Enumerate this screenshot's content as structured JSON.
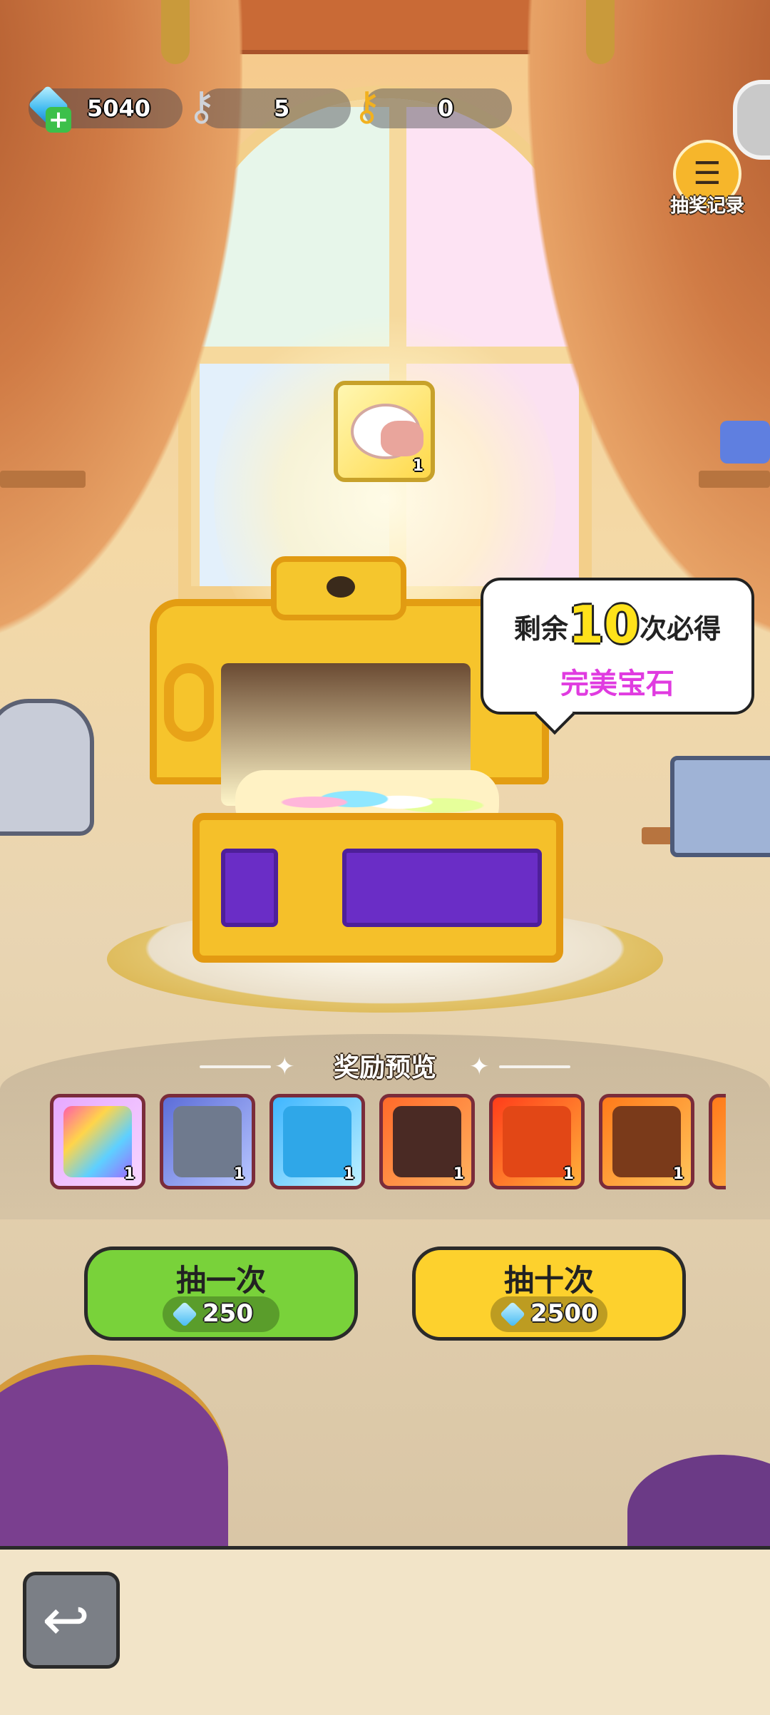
{
  "resources": {
    "gems": {
      "icon": "gem-icon",
      "value": "5040",
      "add_icon": "plus-icon"
    },
    "silver_keys": {
      "icon": "silver-key-icon",
      "value": "5"
    },
    "gold_keys": {
      "icon": "gold-key-icon",
      "value": "0"
    }
  },
  "record_button": {
    "icon": "record-icon",
    "label": "抽奖记录"
  },
  "featured_reward": {
    "icon": "pet-icon",
    "count": "1"
  },
  "bubble": {
    "prefix": "剩余",
    "number": "10",
    "suffix": "次必得",
    "reward": "完美宝石"
  },
  "preview": {
    "title": "奖励预览",
    "items": [
      {
        "icon": "mystery-gem-box-icon",
        "count": "1"
      },
      {
        "icon": "armored-knight-icon",
        "count": "1"
      },
      {
        "icon": "blue-beast-icon",
        "count": "1"
      },
      {
        "icon": "martial-hero-icon",
        "count": "1"
      },
      {
        "icon": "fire-dragon-icon",
        "count": "1"
      },
      {
        "icon": "lava-golem-icon",
        "count": "1"
      }
    ]
  },
  "draw_once": {
    "label": "抽一次",
    "price": "250"
  },
  "draw_ten": {
    "label": "抽十次",
    "price": "2500"
  },
  "back_button": {
    "icon": "back-arrow-icon"
  },
  "colors": {
    "green_button": "#79d23a",
    "yellow_button": "#fdd12d",
    "accent_magenta": "#e03be0"
  }
}
